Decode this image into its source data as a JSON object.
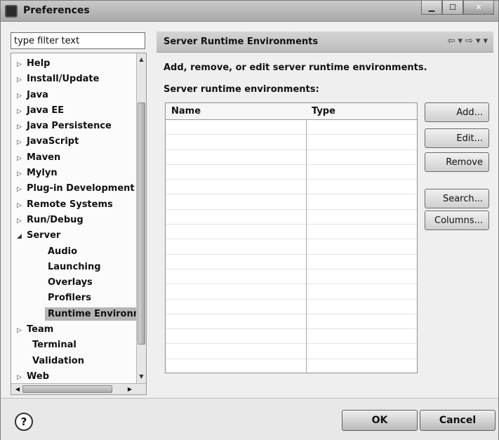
{
  "window": {
    "title": "Preferences"
  },
  "filter": {
    "placeholder": "type filter text",
    "value": "type filter text"
  },
  "tree": {
    "help": "Help",
    "install_update": "Install/Update",
    "java": "Java",
    "java_ee": "Java EE",
    "java_persistence": "Java Persistence",
    "javascript": "JavaScript",
    "maven": "Maven",
    "mylyn": "Mylyn",
    "plugin_development": "Plug-in Development",
    "remote_systems": "Remote Systems",
    "run_debug": "Run/Debug",
    "server": "Server",
    "server_children": {
      "audio": "Audio",
      "launching": "Launching",
      "overlays": "Overlays",
      "profilers": "Profilers",
      "runtime_environments": "Runtime Environm"
    },
    "team": "Team",
    "terminal": "Terminal",
    "validation": "Validation",
    "web": "Web",
    "selected": "Runtime Environments"
  },
  "page": {
    "title": "Server Runtime Environments",
    "description": "Add, remove, or edit server runtime environments.",
    "table_label": "Server runtime environments:",
    "columns": {
      "name": "Name",
      "type": "Type"
    },
    "rows": []
  },
  "buttons": {
    "add": "Add...",
    "edit": "Edit...",
    "remove": "Remove",
    "search": "Search...",
    "columns": "Columns...",
    "ok": "OK",
    "cancel": "Cancel",
    "help": "?"
  },
  "icons": {
    "back": "back-arrow-icon",
    "forward": "forward-arrow-icon",
    "expand": "triangle-right-icon",
    "collapse": "triangle-down-icon"
  }
}
